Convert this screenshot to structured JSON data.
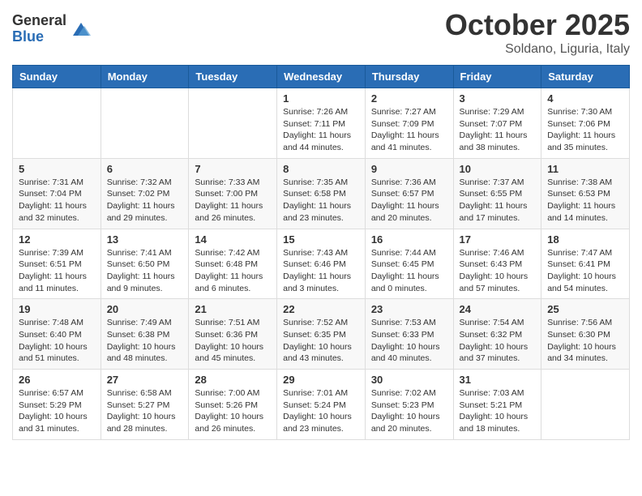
{
  "header": {
    "logo_general": "General",
    "logo_blue": "Blue",
    "main_title": "October 2025",
    "subtitle": "Soldano, Liguria, Italy"
  },
  "weekdays": [
    "Sunday",
    "Monday",
    "Tuesday",
    "Wednesday",
    "Thursday",
    "Friday",
    "Saturday"
  ],
  "weeks": [
    [
      {
        "day": "",
        "sunrise": "",
        "sunset": "",
        "daylight": ""
      },
      {
        "day": "",
        "sunrise": "",
        "sunset": "",
        "daylight": ""
      },
      {
        "day": "",
        "sunrise": "",
        "sunset": "",
        "daylight": ""
      },
      {
        "day": "1",
        "sunrise": "7:26 AM",
        "sunset": "7:11 PM",
        "daylight": "11 hours and 44 minutes."
      },
      {
        "day": "2",
        "sunrise": "7:27 AM",
        "sunset": "7:09 PM",
        "daylight": "11 hours and 41 minutes."
      },
      {
        "day": "3",
        "sunrise": "7:29 AM",
        "sunset": "7:07 PM",
        "daylight": "11 hours and 38 minutes."
      },
      {
        "day": "4",
        "sunrise": "7:30 AM",
        "sunset": "7:06 PM",
        "daylight": "11 hours and 35 minutes."
      }
    ],
    [
      {
        "day": "5",
        "sunrise": "7:31 AM",
        "sunset": "7:04 PM",
        "daylight": "11 hours and 32 minutes."
      },
      {
        "day": "6",
        "sunrise": "7:32 AM",
        "sunset": "7:02 PM",
        "daylight": "11 hours and 29 minutes."
      },
      {
        "day": "7",
        "sunrise": "7:33 AM",
        "sunset": "7:00 PM",
        "daylight": "11 hours and 26 minutes."
      },
      {
        "day": "8",
        "sunrise": "7:35 AM",
        "sunset": "6:58 PM",
        "daylight": "11 hours and 23 minutes."
      },
      {
        "day": "9",
        "sunrise": "7:36 AM",
        "sunset": "6:57 PM",
        "daylight": "11 hours and 20 minutes."
      },
      {
        "day": "10",
        "sunrise": "7:37 AM",
        "sunset": "6:55 PM",
        "daylight": "11 hours and 17 minutes."
      },
      {
        "day": "11",
        "sunrise": "7:38 AM",
        "sunset": "6:53 PM",
        "daylight": "11 hours and 14 minutes."
      }
    ],
    [
      {
        "day": "12",
        "sunrise": "7:39 AM",
        "sunset": "6:51 PM",
        "daylight": "11 hours and 11 minutes."
      },
      {
        "day": "13",
        "sunrise": "7:41 AM",
        "sunset": "6:50 PM",
        "daylight": "11 hours and 9 minutes."
      },
      {
        "day": "14",
        "sunrise": "7:42 AM",
        "sunset": "6:48 PM",
        "daylight": "11 hours and 6 minutes."
      },
      {
        "day": "15",
        "sunrise": "7:43 AM",
        "sunset": "6:46 PM",
        "daylight": "11 hours and 3 minutes."
      },
      {
        "day": "16",
        "sunrise": "7:44 AM",
        "sunset": "6:45 PM",
        "daylight": "11 hours and 0 minutes."
      },
      {
        "day": "17",
        "sunrise": "7:46 AM",
        "sunset": "6:43 PM",
        "daylight": "10 hours and 57 minutes."
      },
      {
        "day": "18",
        "sunrise": "7:47 AM",
        "sunset": "6:41 PM",
        "daylight": "10 hours and 54 minutes."
      }
    ],
    [
      {
        "day": "19",
        "sunrise": "7:48 AM",
        "sunset": "6:40 PM",
        "daylight": "10 hours and 51 minutes."
      },
      {
        "day": "20",
        "sunrise": "7:49 AM",
        "sunset": "6:38 PM",
        "daylight": "10 hours and 48 minutes."
      },
      {
        "day": "21",
        "sunrise": "7:51 AM",
        "sunset": "6:36 PM",
        "daylight": "10 hours and 45 minutes."
      },
      {
        "day": "22",
        "sunrise": "7:52 AM",
        "sunset": "6:35 PM",
        "daylight": "10 hours and 43 minutes."
      },
      {
        "day": "23",
        "sunrise": "7:53 AM",
        "sunset": "6:33 PM",
        "daylight": "10 hours and 40 minutes."
      },
      {
        "day": "24",
        "sunrise": "7:54 AM",
        "sunset": "6:32 PM",
        "daylight": "10 hours and 37 minutes."
      },
      {
        "day": "25",
        "sunrise": "7:56 AM",
        "sunset": "6:30 PM",
        "daylight": "10 hours and 34 minutes."
      }
    ],
    [
      {
        "day": "26",
        "sunrise": "6:57 AM",
        "sunset": "5:29 PM",
        "daylight": "10 hours and 31 minutes."
      },
      {
        "day": "27",
        "sunrise": "6:58 AM",
        "sunset": "5:27 PM",
        "daylight": "10 hours and 28 minutes."
      },
      {
        "day": "28",
        "sunrise": "7:00 AM",
        "sunset": "5:26 PM",
        "daylight": "10 hours and 26 minutes."
      },
      {
        "day": "29",
        "sunrise": "7:01 AM",
        "sunset": "5:24 PM",
        "daylight": "10 hours and 23 minutes."
      },
      {
        "day": "30",
        "sunrise": "7:02 AM",
        "sunset": "5:23 PM",
        "daylight": "10 hours and 20 minutes."
      },
      {
        "day": "31",
        "sunrise": "7:03 AM",
        "sunset": "5:21 PM",
        "daylight": "10 hours and 18 minutes."
      },
      {
        "day": "",
        "sunrise": "",
        "sunset": "",
        "daylight": ""
      }
    ]
  ],
  "labels": {
    "sunrise": "Sunrise:",
    "sunset": "Sunset:",
    "daylight": "Daylight:"
  }
}
